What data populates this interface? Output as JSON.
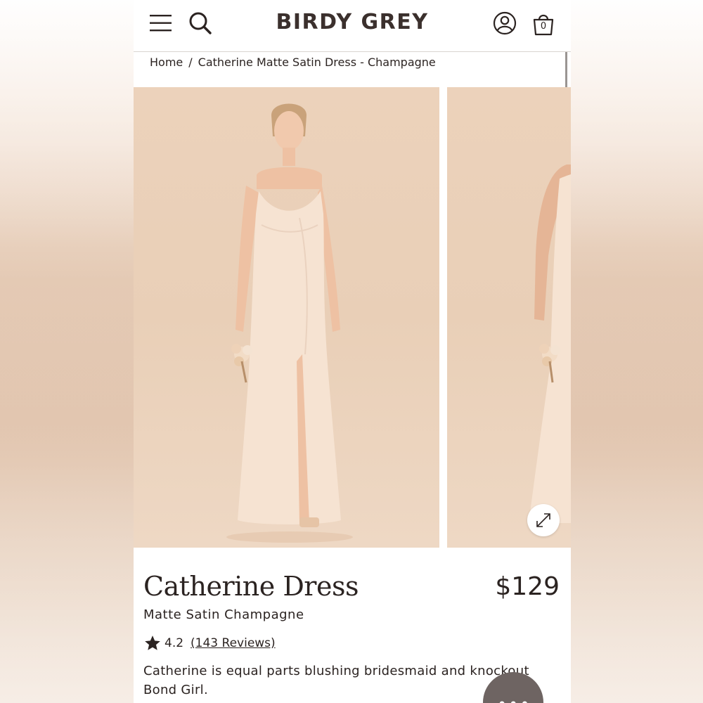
{
  "header": {
    "logo": "BIRDY GREY",
    "bag_count": "0",
    "icons": [
      "menu-icon",
      "search-icon",
      "account-icon",
      "bag-icon"
    ]
  },
  "breadcrumb": {
    "home": "Home",
    "separator": "/",
    "current": "Catherine Matte Satin Dress - Champagne"
  },
  "gallery": {
    "background_color": "#e9cfb7",
    "dress_color": "#f6e3d2"
  },
  "product": {
    "title": "Catherine Dress",
    "price": "$129",
    "variant": "Matte Satin Champagne",
    "rating": "4.2",
    "reviews": "(143 Reviews)",
    "description": "Catherine is equal parts blushing bridesmaid and knockout Bond Girl."
  },
  "chat": {
    "icon": "chat-icon",
    "dots": "•••"
  }
}
